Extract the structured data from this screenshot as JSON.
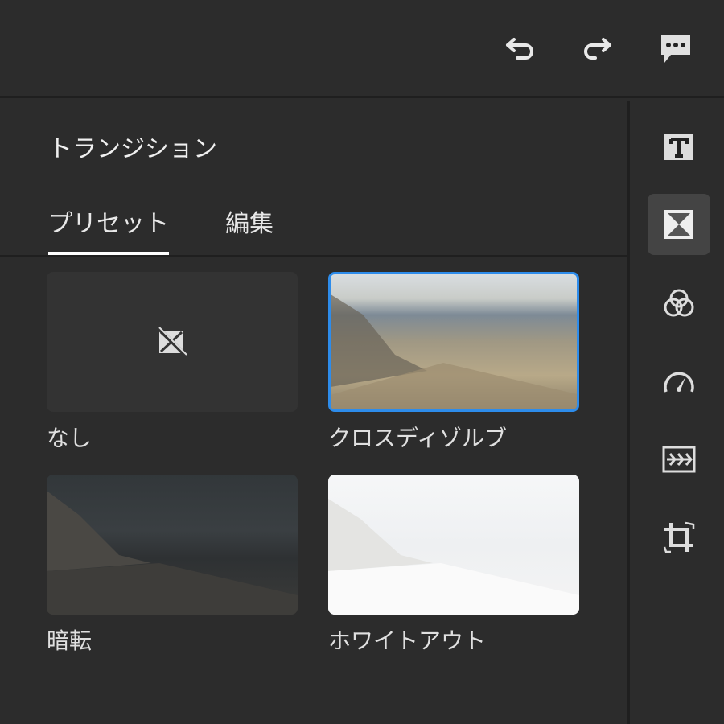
{
  "toolbar": {
    "undo": "undo-icon",
    "redo": "redo-icon",
    "comments": "comment-icon"
  },
  "panel": {
    "title": "トランジション",
    "tabs": [
      {
        "label": "プリセット",
        "active": true
      },
      {
        "label": "編集",
        "active": false
      }
    ]
  },
  "presets": [
    {
      "label": "なし",
      "selected": false
    },
    {
      "label": "クロスディゾルブ",
      "selected": true
    },
    {
      "label": "暗転",
      "selected": false
    },
    {
      "label": "ホワイトアウト",
      "selected": false
    }
  ],
  "rail": [
    "titles-icon",
    "transitions-icon",
    "color-icon",
    "speed-icon",
    "audio-icon",
    "crop-icon"
  ],
  "colors": {
    "accent": "#2d8ceb",
    "bg": "#2c2c2c"
  }
}
